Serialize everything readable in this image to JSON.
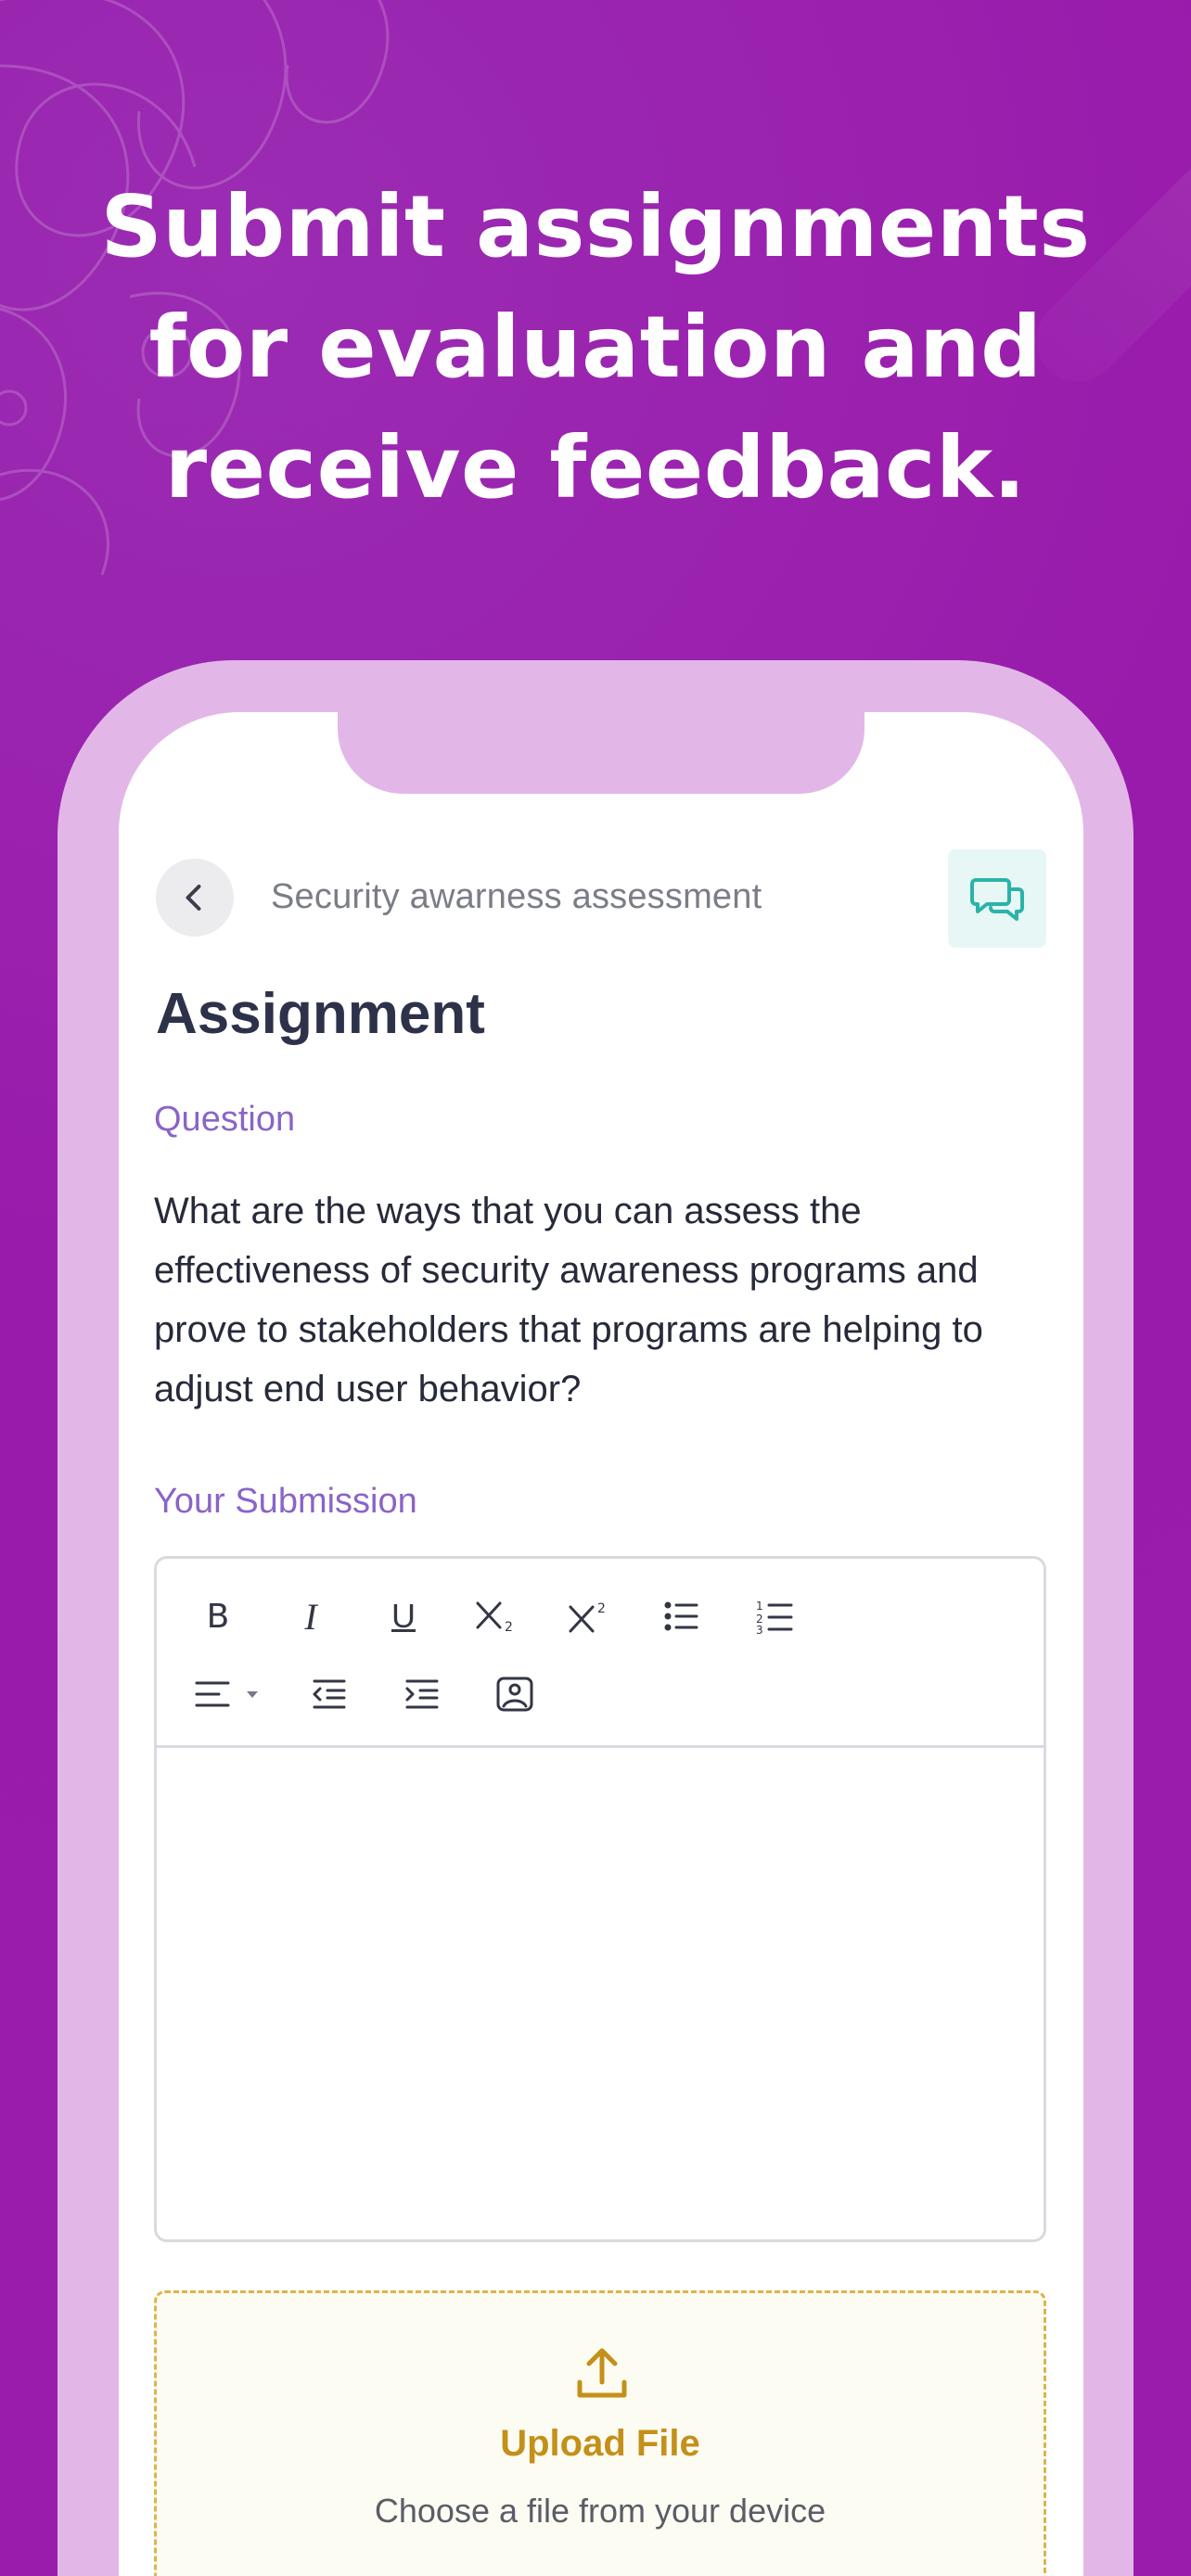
{
  "headline": {
    "line1": "Submit assignments",
    "line2": "for evaluation and",
    "line3": "receive feedback."
  },
  "topbar": {
    "title": "Security awarness assessment",
    "back_icon": "chevron-left-icon",
    "chat_icon": "chat-bubbles-icon"
  },
  "page": {
    "title": "Assignment"
  },
  "question": {
    "label": "Question",
    "text": "What are the ways that you can assess the effectiveness of security awareness programs and prove to stakeholders that programs are helping to adjust end user behavior?"
  },
  "submission": {
    "label": "Your Submission",
    "toolbar": {
      "bold": "B",
      "italic": "I",
      "underline": "U"
    }
  },
  "upload": {
    "title": "Upload File",
    "subtitle": "Choose a file from your device"
  },
  "colors": {
    "background": "#9a1ead",
    "phone_frame": "#e2b7e7",
    "accent_purple": "#8a64c8",
    "teal": "#2bb3a8",
    "upload_gold": "#c4901a"
  }
}
